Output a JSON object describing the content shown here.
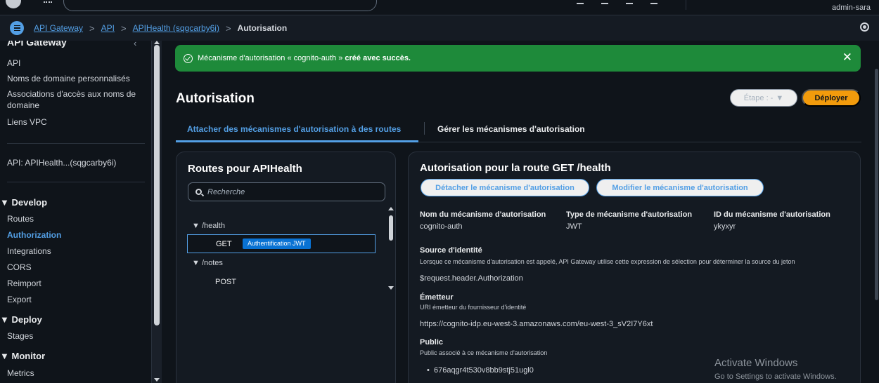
{
  "topbar": {
    "user": "admin-sara"
  },
  "breadcrumb": {
    "items": [
      "API Gateway",
      "API",
      "APIHealth (sqgcarby6i)"
    ],
    "current": "Autorisation",
    "separator": ">"
  },
  "sidebar": {
    "title": "API Gateway",
    "collapse_glyph": "‹",
    "top_links": [
      "API",
      "Noms de domaine personnalisés",
      "Associations d'accès aux noms de domaine",
      "Liens VPC"
    ],
    "api_name": "API: APIHealth...(sqgcarby6i)",
    "sections": [
      {
        "label": "Develop",
        "items": [
          "Routes",
          "Authorization",
          "Integrations",
          "CORS",
          "Reimport",
          "Export"
        ]
      },
      {
        "label": "Deploy",
        "items": [
          "Stages"
        ]
      },
      {
        "label": "Monitor",
        "items": [
          "Metrics"
        ]
      }
    ],
    "active_item": "Authorization"
  },
  "banner": {
    "text_prefix": "Mécanisme d'autorisation « cognito-auth »",
    "text_bold": "créé avec succès.",
    "close_glyph": "✕",
    "color": "#1e8a3a"
  },
  "page": {
    "title": "Autorisation",
    "stage_label": "Étape : -",
    "stage_caret": "▼",
    "deploy_label": "Déployer"
  },
  "tabs": [
    {
      "label": "Attacher des mécanismes d'autorisation à des routes",
      "active": true
    },
    {
      "label": "Gérer les mécanismes d'autorisation",
      "active": false
    }
  ],
  "routes": {
    "title": "Routes pour APIHealth",
    "search_placeholder": "Recherche",
    "tree": [
      {
        "path": "▼ /health",
        "methods": [
          {
            "method": "GET",
            "badge": "Authentification JWT",
            "selected": true
          }
        ]
      },
      {
        "path": "▼ /notes",
        "methods": [
          {
            "method": "POST",
            "badge": "",
            "selected": false
          }
        ]
      }
    ]
  },
  "detail": {
    "title": "Autorisation pour la route GET /health",
    "detach_label": "Détacher le mécanisme d'autorisation",
    "modify_label": "Modifier le mécanisme d'autorisation",
    "fields": [
      {
        "label": "Nom du mécanisme d'autorisation",
        "value": "cognito-auth"
      },
      {
        "label": "Type de mécanisme d'autorisation",
        "value": "JWT"
      },
      {
        "label": "ID du mécanisme d'autorisation",
        "value": "ykyxyr"
      }
    ],
    "identity_source": {
      "label": "Source d'identité",
      "description": "Lorsque ce mécanisme d'autorisation est appelé, API Gateway utilise cette expression de sélection pour déterminer la source du jeton",
      "value": "$request.header.Authorization"
    },
    "issuer": {
      "label": "Émetteur",
      "description": "URI émetteur du fournisseur d'identité",
      "value": "https://cognito-idp.eu-west-3.amazonaws.com/eu-west-3_sV2I7Y6xt"
    },
    "audience": {
      "label": "Public",
      "description": "Public associé à ce mécanisme d'autorisation",
      "values": [
        "676aqgr4t530v8bb9stj51ugl0"
      ]
    }
  },
  "watermark": {
    "line1": "Activate Windows",
    "line2": "Go to Settings to activate Windows."
  },
  "colors": {
    "accent": "#539fe5",
    "deploy": "#f29b0c",
    "success": "#1e8a3a",
    "badge": "#0972d3",
    "background": "#0f141a"
  }
}
